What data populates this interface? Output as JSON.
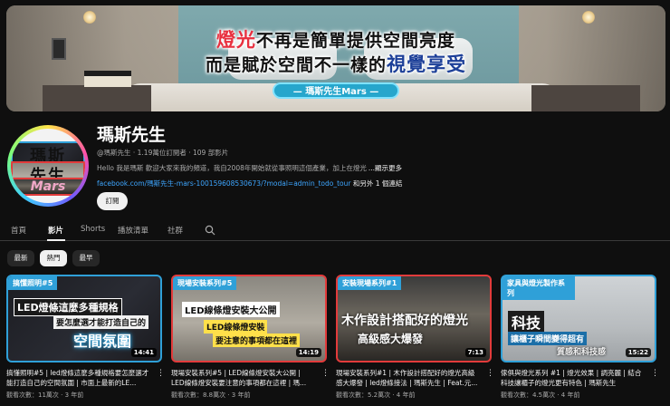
{
  "banner": {
    "line1_highlight": "燈光",
    "line1_rest": "不再是簡單提供空間亮度",
    "line2_rest": "而是賦於空間不一樣的",
    "line2_highlight": "視覺享受",
    "tag": "— 瑪斯先生Mars —"
  },
  "channel": {
    "avatar_line1": "瑪斯",
    "avatar_line2": "先生",
    "avatar_line3": "Mars",
    "name": "瑪斯先生",
    "meta": "@瑪斯先生 · 1.19萬位訂閱者 · 109 部影片",
    "description": "Hello 我是瑪斯 歡迎大家來我的頻道，我自2008年開始就從事照明這個產業，加上在燈光",
    "more": "...顯示更多",
    "link_url": "facebook.com/瑪斯先生-mars-100159608530673/?modal=admin_todo_tour",
    "link_more": " 和另外 1 個連結",
    "subscribe_label": "訂閱"
  },
  "tabs": [
    {
      "label": "首頁"
    },
    {
      "label": "影片"
    },
    {
      "label": "Shorts"
    },
    {
      "label": "播放清單"
    },
    {
      "label": "社群"
    }
  ],
  "chips": [
    {
      "label": "最新"
    },
    {
      "label": "熱門"
    },
    {
      "label": "最早"
    }
  ],
  "videos": [
    {
      "tag": "搞懂照明#5",
      "cap1": "LED燈條這麼多種規格",
      "cap2": "要怎麼選才能打造自己的",
      "cap3": "空間氛圍",
      "duration": "14:41",
      "title": "搞懂照明#5 | led燈條這麼多種規格要怎麼選才能打造自己的空間氛圍 | 市面上最新的LE...",
      "meta": "觀看次數：11萬次 · 3 年前"
    },
    {
      "tag": "現場安裝系列#5",
      "cap1": "LED線條燈安裝大公開",
      "cap2": "LED線條燈安裝",
      "cap3": "要注意的事項都在這裡",
      "duration": "14:19",
      "title": "現場安裝系列#5 | LED線條燈安裝大公開 | LED線條燈安裝要注意的事項都在這裡 | 瑪...",
      "meta": "觀看次數：8.8萬次 · 3 年前"
    },
    {
      "tag": "安裝現場系列#1",
      "cap1": "木作設計搭配好的燈光",
      "cap2": "高級感大爆發",
      "cap3": "",
      "duration": "7:13",
      "title": "現場安裝系列#1 | 木作設計搭配好的燈光高級感大爆發 | led燈條接法 | 瑪斯先生 | Feat.元...",
      "meta": "觀看次數：5.2萬次 · 4 年前"
    },
    {
      "tag": "家具與燈光製作系列",
      "cap1": "科技",
      "cap2": "讓櫃子瞬間變得超有",
      "cap3": "質感和科技感",
      "duration": "15:22",
      "title": "傢俱與燈光系列 #1 | 燈光效果 | 調亮麗 | 結合科技讓櫃子的燈光更有特色 | 瑪斯先生",
      "meta": "觀看次數：4.5萬次 · 4 年前"
    }
  ]
}
